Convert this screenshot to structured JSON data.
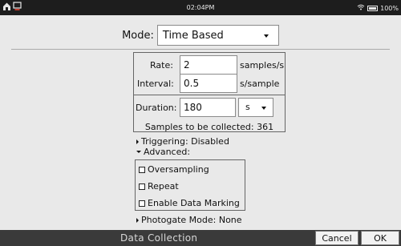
{
  "status_bar": {
    "time": "02:04PM",
    "battery_text": "100%",
    "icons": [
      "home-icon",
      "screen-icon",
      "wifi-icon",
      "battery-icon"
    ]
  },
  "mode": {
    "label": "Mode:",
    "value": "Time Based"
  },
  "settings": {
    "rate_label": "Rate:",
    "rate_value": "2",
    "rate_unit": "samples/s",
    "interval_label": "Interval:",
    "interval_value": "0.5",
    "interval_unit": "s/sample",
    "duration_label": "Duration:",
    "duration_value": "180",
    "duration_unit": "s",
    "samples_text": "Samples to be collected: 361"
  },
  "triggering": {
    "label": "Triggering: Disabled"
  },
  "advanced": {
    "label": "Advanced:",
    "options": [
      "Oversampling",
      "Repeat",
      "Enable Data Marking"
    ]
  },
  "photogate": {
    "label": "Photogate Mode: None"
  },
  "footer": {
    "title": "Data Collection",
    "cancel_label": "Cancel",
    "ok_label": "OK"
  }
}
